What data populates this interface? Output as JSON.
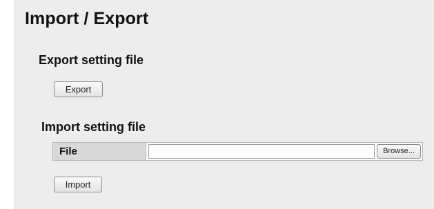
{
  "page": {
    "title": "Import / Export"
  },
  "export_section": {
    "title": "Export setting file",
    "button_label": "Export"
  },
  "import_section": {
    "title": "Import setting file",
    "file_label": "File",
    "file_value": "",
    "browse_label": "Browse...",
    "button_label": "Import"
  }
}
